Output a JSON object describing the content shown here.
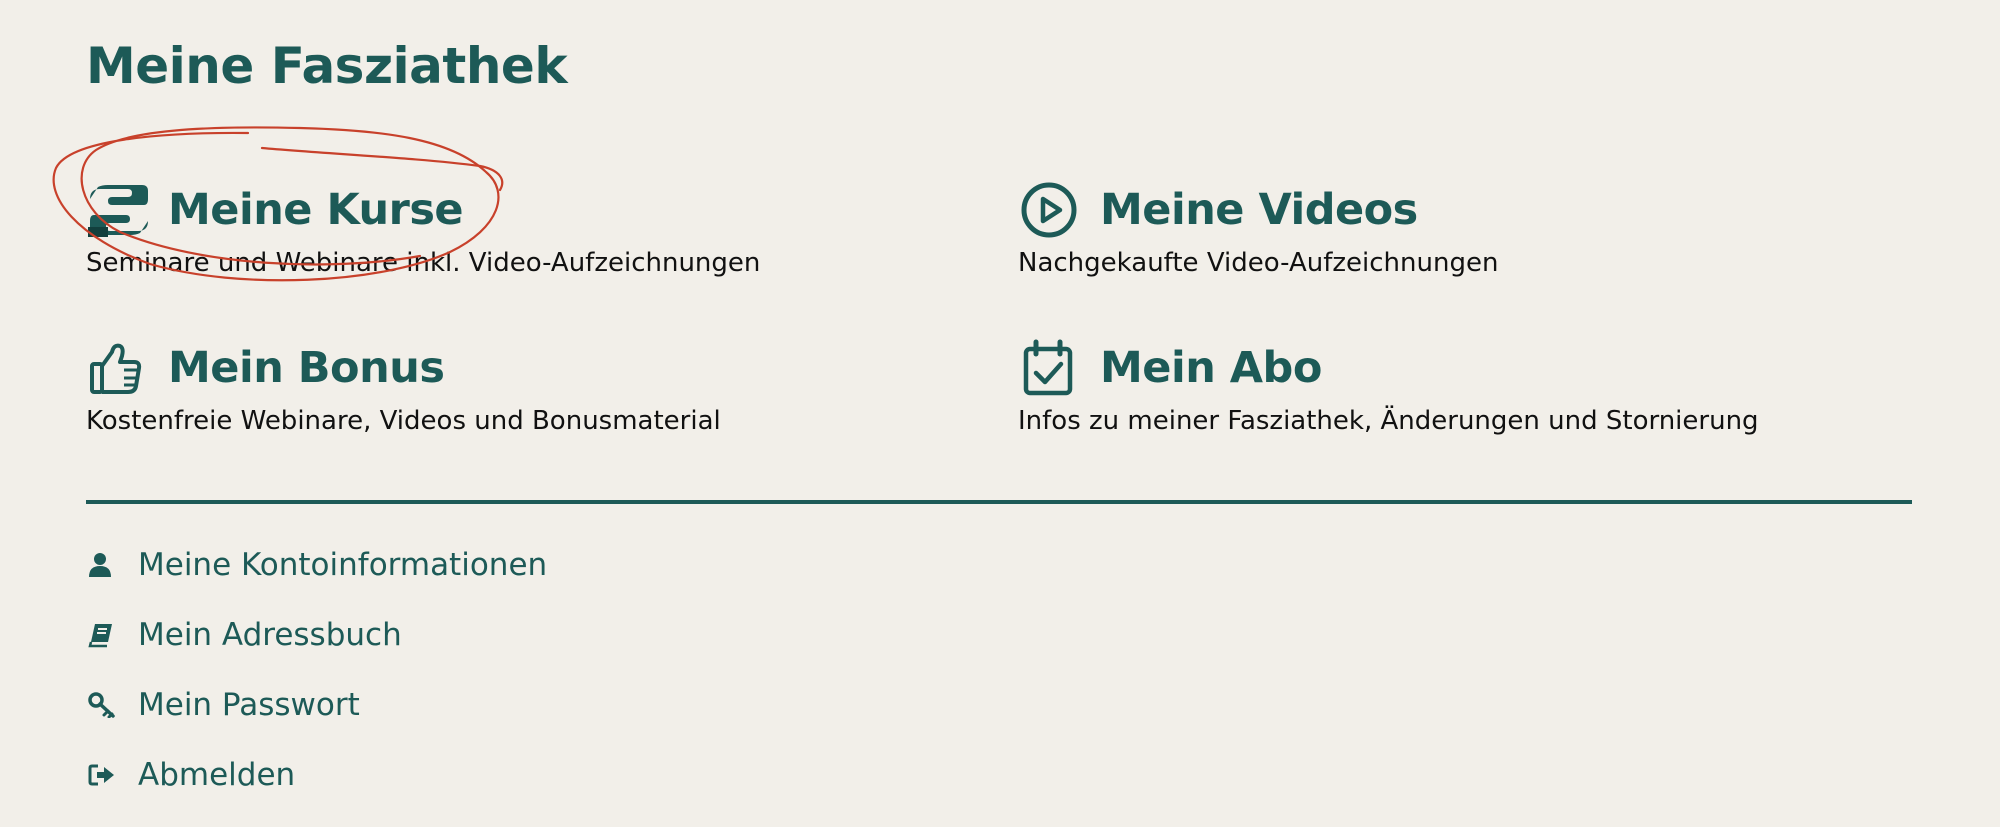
{
  "page": {
    "title": "Meine Fasziathek"
  },
  "cards": [
    {
      "icon": "hand-offering-icon",
      "title": "Meine Kurse",
      "description": "Seminare und Webinare inkl. Video-Aufzeichnungen"
    },
    {
      "icon": "play-circle-icon",
      "title": "Meine Videos",
      "description": "Nachgekaufte Video-Aufzeichnungen"
    },
    {
      "icon": "thumbs-up-icon",
      "title": "Mein Bonus",
      "description": "Kostenfreie Webinare, Videos und Bonusmaterial"
    },
    {
      "icon": "calendar-check-icon",
      "title": "Mein Abo",
      "description": "Infos zu meiner Fasziathek, Änderungen und Stornierung"
    }
  ],
  "account_menu": [
    {
      "icon": "user-icon",
      "label": "Meine Kontoinformationen"
    },
    {
      "icon": "address-book-icon",
      "label": "Mein Adressbuch"
    },
    {
      "icon": "key-icon",
      "label": "Mein Passwort"
    },
    {
      "icon": "sign-out-icon",
      "label": "Abmelden"
    }
  ],
  "colors": {
    "background": "#f2efe9",
    "brand": "#1d5a57",
    "text": "#111111",
    "annotation": "#c8412b"
  }
}
